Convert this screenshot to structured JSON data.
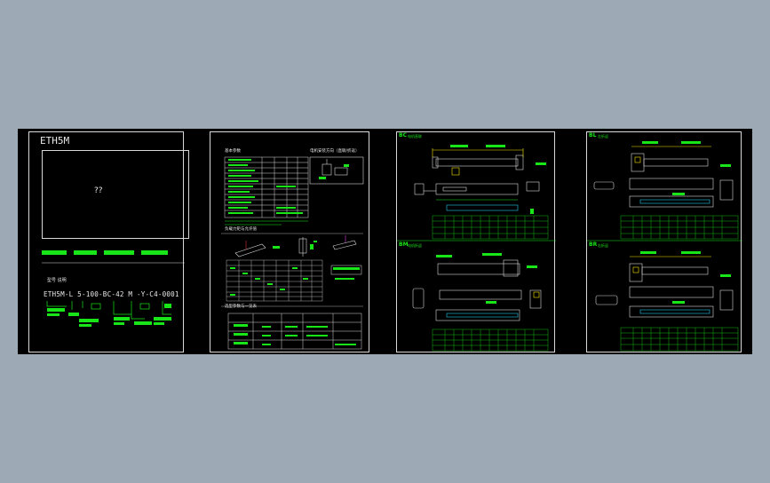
{
  "colors": {
    "background": "#9ea9b6",
    "canvas": "#000000",
    "line": "#d8d8d8",
    "green": "#19e619",
    "yellow": "#f5e400",
    "cyan": "#21c8e8",
    "magenta": "#e040e0",
    "red": "#e03030"
  },
  "sheet1": {
    "title": "ETH5M",
    "placeholder": "??",
    "model_label": "型号 说明",
    "model_code": "ETH5M-L 5-100-BC-42 M -Y-C4-0001"
  },
  "sheet2": {
    "heading_spec": "基本参数",
    "heading_diagram": "电机安装方向（直联/折返）",
    "heading_load": "负载力矩与允许值",
    "heading_table": "选型参数与一览表"
  },
  "sheet3": {
    "top_label": "BC",
    "top_title": "电机直联",
    "bottom_label": "BM",
    "bottom_title": "电机折返"
  },
  "sheet4": {
    "top_label": "BL",
    "top_title": "左折返",
    "bottom_label": "BR",
    "bottom_title": "右折返"
  }
}
